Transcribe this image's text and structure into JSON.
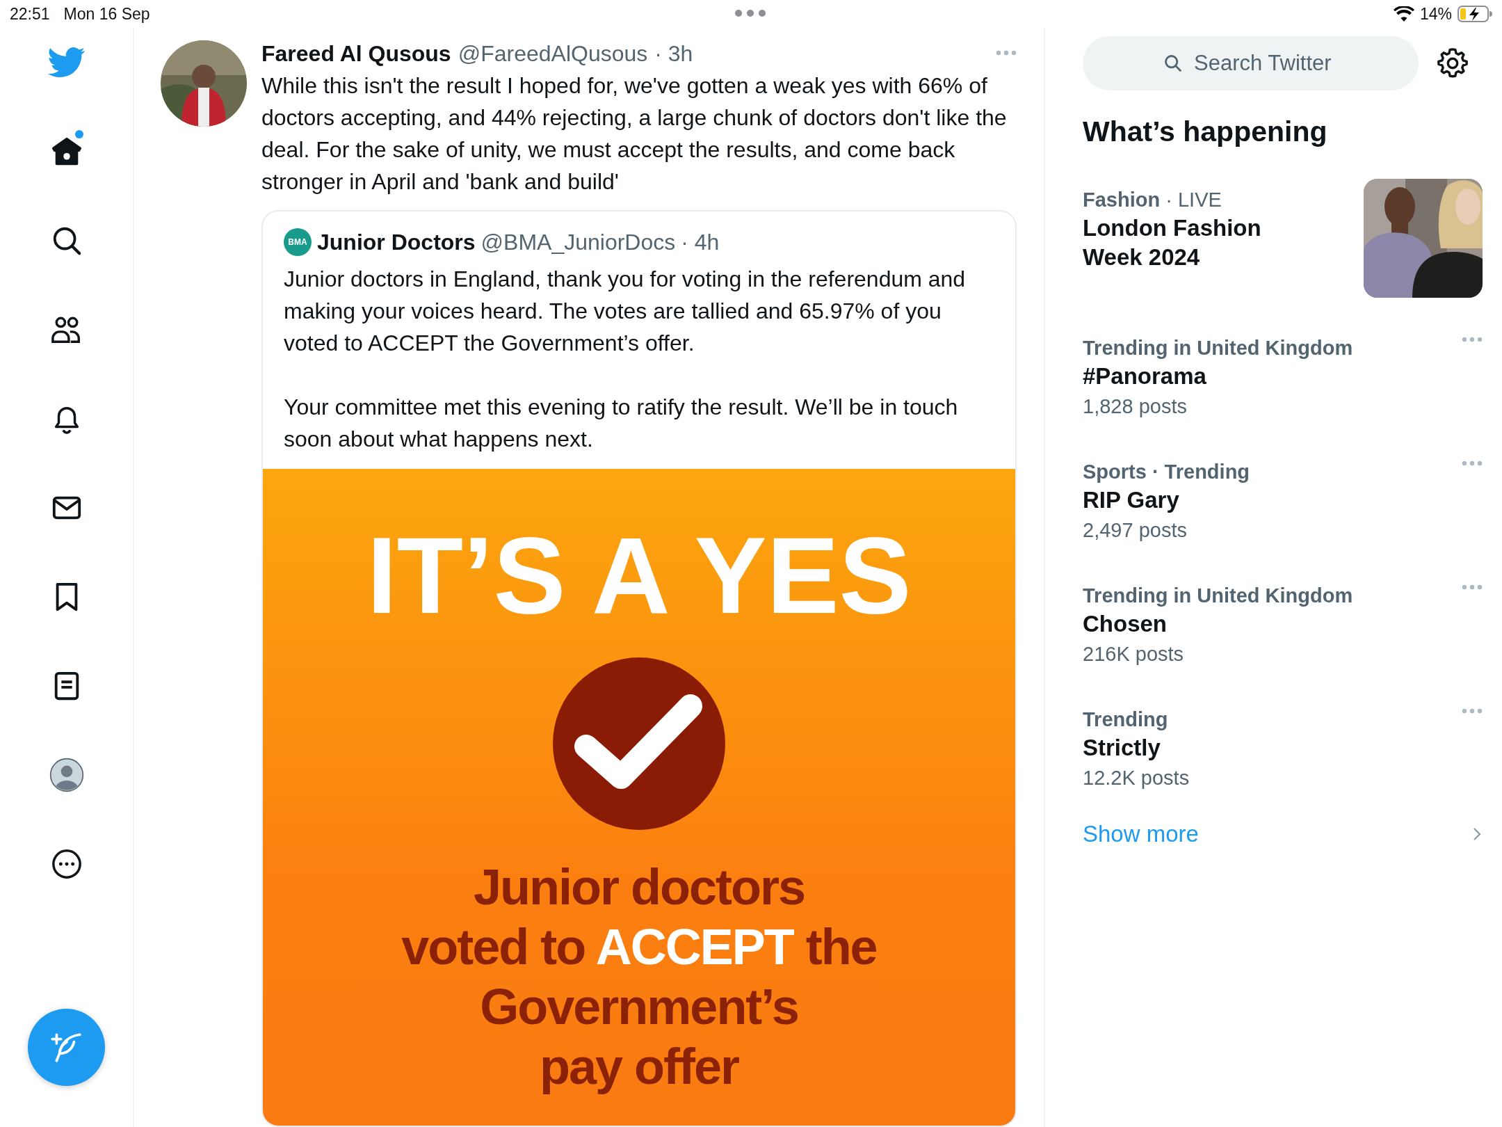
{
  "status_bar": {
    "time": "22:51",
    "date": "Mon 16 Sep",
    "battery": "14%"
  },
  "sidebar": {
    "items": [
      {
        "kind": "home",
        "selected": true,
        "unread": true
      },
      {
        "kind": "explore",
        "selected": false,
        "unread": false
      },
      {
        "kind": "communities",
        "selected": false,
        "unread": false
      },
      {
        "kind": "notifications",
        "selected": false,
        "unread": false
      },
      {
        "kind": "messages",
        "selected": false,
        "unread": false
      },
      {
        "kind": "bookmarks",
        "selected": false,
        "unread": false
      },
      {
        "kind": "lists",
        "selected": false,
        "unread": false
      },
      {
        "kind": "profile",
        "selected": false,
        "unread": false
      },
      {
        "kind": "more",
        "selected": false,
        "unread": false
      }
    ]
  },
  "tweet": {
    "author": "Fareed Al Qusous",
    "handle": "@FareedAlQusous",
    "time": "· 3h",
    "text": "While this isn't the result I hoped for, we've gotten a weak yes with 66% of doctors accepting, and 44% rejecting, a large chunk of doctors don't like the deal. For the sake of unity, we must accept the results, and come back stronger in April and 'bank and build'",
    "quote": {
      "avatar_text": "BMA",
      "author": "Junior Doctors",
      "handle": "@BMA_JuniorDocs",
      "time": "· 4h",
      "paragraphs": [
        "Junior doctors in England, thank you for voting in the referendum and making your voices heard. The votes are tallied and 65.97% of you voted to ACCEPT the Government’s offer.",
        "Your committee met this evening to ratify the result. We’ll be in touch soon about what happens next."
      ],
      "media": {
        "headline": "IT’S A YES",
        "lines": [
          [
            {
              "text": "Junior doctors",
              "highlight": false
            }
          ],
          [
            {
              "text": "voted to ",
              "highlight": false
            },
            {
              "text": "ACCEPT",
              "highlight": true
            },
            {
              "text": " the",
              "highlight": false
            }
          ],
          [
            {
              "text": "Government’s",
              "highlight": false
            }
          ],
          [
            {
              "text": "pay offer",
              "highlight": false
            }
          ]
        ]
      }
    }
  },
  "search": {
    "placeholder": "Search Twitter"
  },
  "trends_title": "What’s happening",
  "trends": [
    {
      "kind": "media",
      "context": "**Fashion** · LIVE",
      "title": "London Fashion Week 2024"
    },
    {
      "kind": "trend",
      "context": "Trending in United Kingdom",
      "title": "#Panorama",
      "count": "1,828 posts"
    },
    {
      "kind": "trend",
      "context": "Sports · Trending",
      "title": "RIP Gary",
      "count": "2,497 posts"
    },
    {
      "kind": "trend",
      "context": "Trending in United Kingdom",
      "title": "Chosen",
      "count": "216K posts"
    },
    {
      "kind": "trend",
      "context": "Trending",
      "title": "Strictly",
      "count": "12.2K posts"
    }
  ],
  "show_more": "Show more"
}
